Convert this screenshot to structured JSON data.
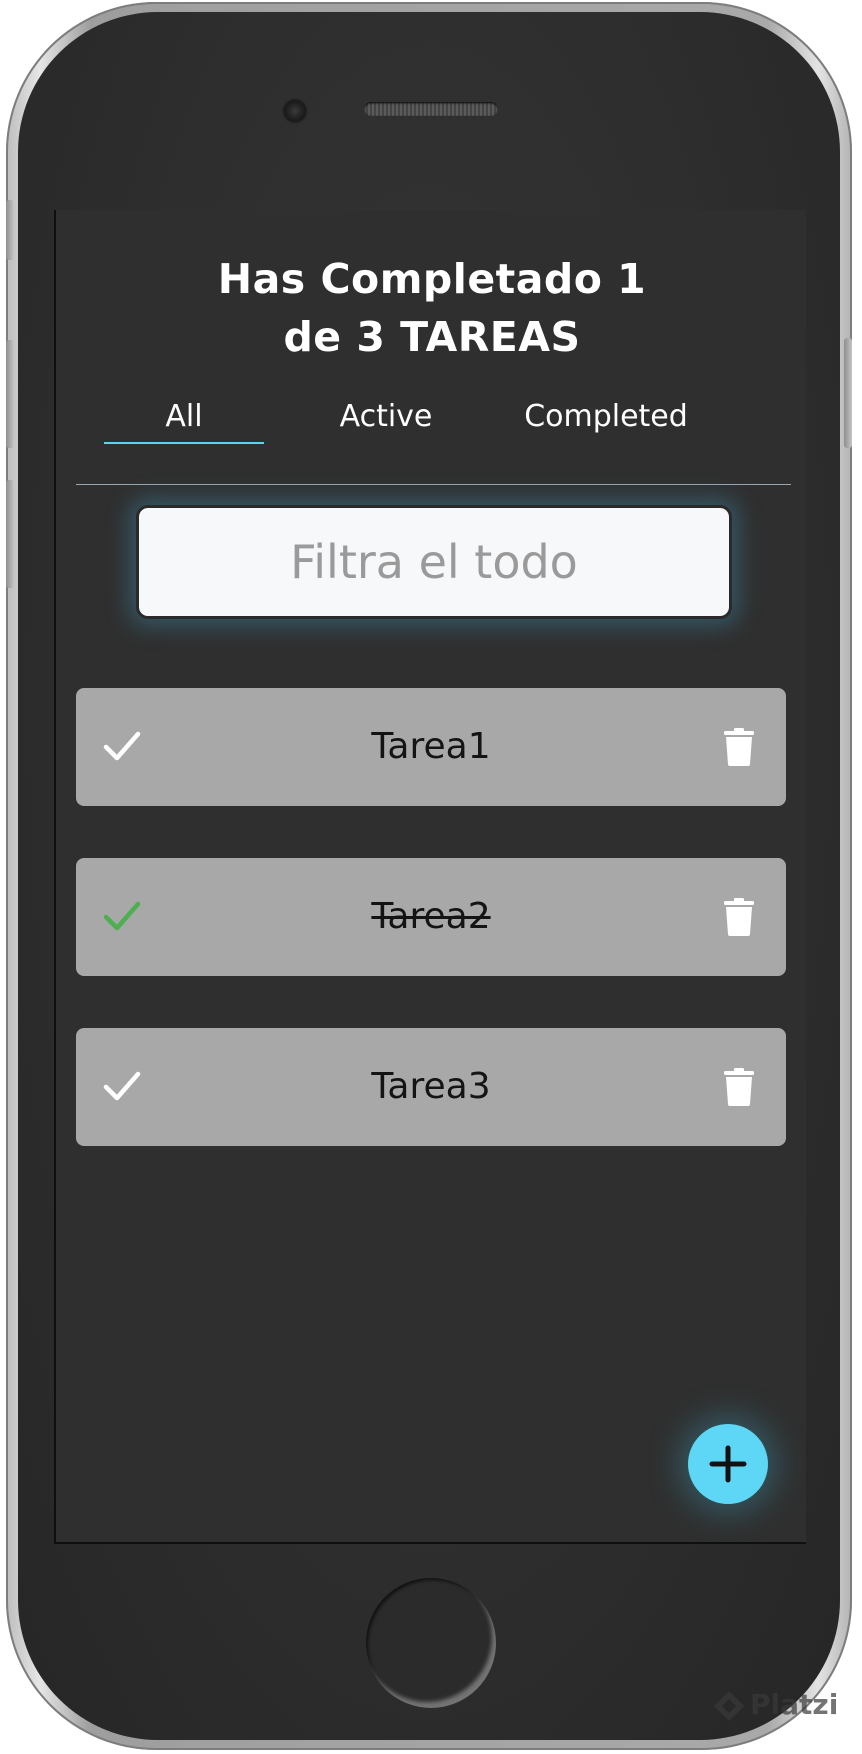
{
  "header": {
    "title_line1": "Has Completado 1",
    "title_line2": "de 3 TAREAS"
  },
  "tabs": [
    {
      "label": "All",
      "active": true
    },
    {
      "label": "Active",
      "active": false
    },
    {
      "label": "Completed",
      "active": false
    }
  ],
  "search": {
    "placeholder": "Filtra el todo",
    "value": ""
  },
  "todos": [
    {
      "text": "Tarea1",
      "completed": false,
      "check_icon": "check-icon",
      "delete_icon": "trash-icon"
    },
    {
      "text": "Tarea2",
      "completed": true,
      "check_icon": "check-icon",
      "delete_icon": "trash-icon"
    },
    {
      "text": "Tarea3",
      "completed": false,
      "check_icon": "check-icon",
      "delete_icon": "trash-icon"
    }
  ],
  "fab": {
    "icon": "plus-icon"
  },
  "watermark": {
    "text": "Platzi"
  },
  "colors": {
    "screen_background": "#2f2f2f",
    "accent": "#5dd7f5",
    "todo_background": "#a8a8a8",
    "check_completed": "#4caf50",
    "check_default": "#ffffff",
    "tab_underline": "#5fd3ee"
  }
}
